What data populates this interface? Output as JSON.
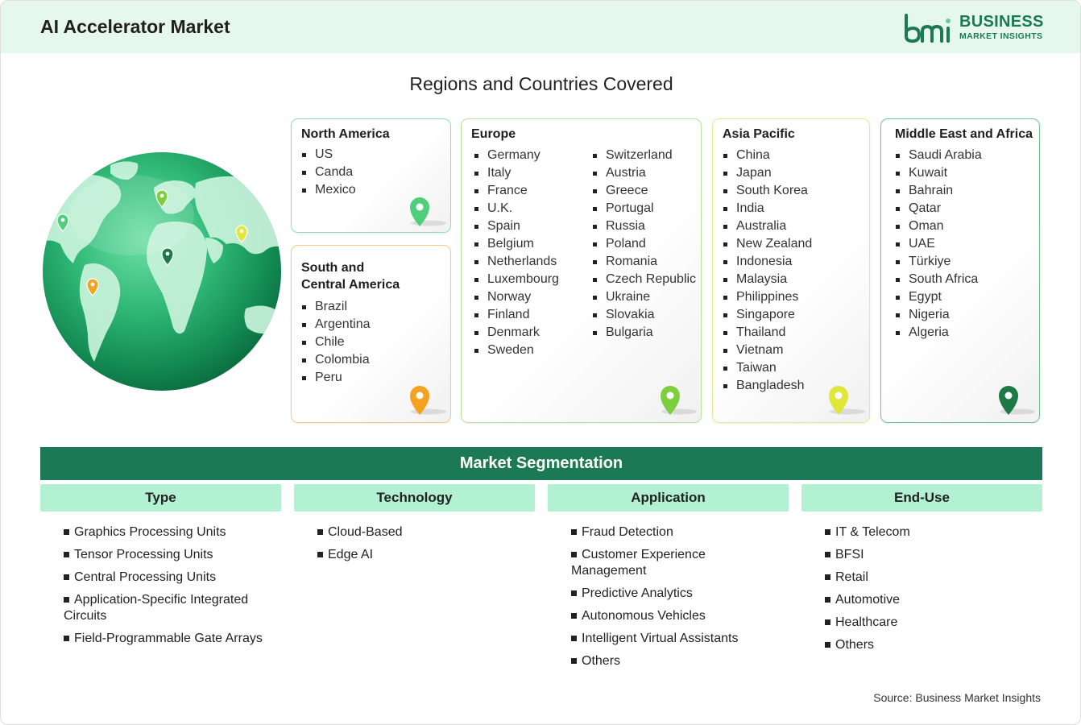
{
  "header": {
    "title": "AI Accelerator Market"
  },
  "logo": {
    "line1": "BUSINESS",
    "line2": "MARKET INSIGHTS"
  },
  "subtitle": "Regions and Countries Covered",
  "regions": {
    "north_america": {
      "title": "North America",
      "countries": [
        "US",
        "Canda",
        "Mexico"
      ],
      "pin_color": "#4fcf7b"
    },
    "south_central_america": {
      "title_line1": "South and",
      "title_line2": "Central America",
      "countries": [
        "Brazil",
        "Argentina",
        "Chile",
        "Colombia",
        "Peru"
      ],
      "pin_color": "#f5a21f"
    },
    "europe": {
      "title": "Europe",
      "col1": [
        "Germany",
        "Italy",
        "France",
        "U.K.",
        "Spain",
        "Belgium",
        "Netherlands",
        "Luxembourg",
        "Norway",
        "Finland",
        "Denmark",
        "Sweden"
      ],
      "col2": [
        "Switzerland",
        "Austria",
        "Greece",
        "Portugal",
        "Russia",
        "Poland",
        "Romania",
        "Czech Republic",
        "Ukraine",
        "Slovakia",
        "Bulgaria"
      ],
      "pin_color": "#7ccf3f"
    },
    "asia_pacific": {
      "title": "Asia Pacific",
      "countries": [
        "China",
        "Japan",
        "South Korea",
        "India",
        "Australia",
        "New Zealand",
        "Indonesia",
        "Malaysia",
        "Philippines",
        "Singapore",
        "Thailand",
        "Vietnam",
        "Taiwan",
        "Bangladesh"
      ],
      "pin_color": "#e2e63a"
    },
    "mea": {
      "title": "Middle East and Africa",
      "countries": [
        "Saudi Arabia",
        "Kuwait",
        "Bahrain",
        "Qatar",
        "Oman",
        "UAE",
        "Türkiye",
        "South Africa",
        "Egypt",
        "Nigeria",
        "Algeria"
      ],
      "pin_color": "#1b7a45"
    }
  },
  "segmentation": {
    "title": "Market Segmentation",
    "columns": [
      {
        "head": "Type",
        "items": [
          "Graphics Processing Units",
          "Tensor Processing Units",
          "Central Processing Units",
          "Application-Specific Integrated Circuits",
          "Field-Programmable Gate Arrays"
        ]
      },
      {
        "head": "Technology",
        "items": [
          "Cloud-Based",
          "Edge AI"
        ]
      },
      {
        "head": "Application",
        "items": [
          "Fraud Detection",
          "Customer Experience Management",
          "Predictive Analytics",
          "Autonomous Vehicles",
          "Intelligent Virtual Assistants",
          "Others"
        ]
      },
      {
        "head": "End-Use",
        "items": [
          "IT & Telecom",
          "BFSI",
          "Retail",
          "Automotive",
          "Healthcare",
          "Others"
        ]
      }
    ]
  },
  "source": "Source: Business Market Insights",
  "colors": {
    "brand": "#1b7a55",
    "header_bg": "#e6f8ee",
    "seg_head_bg": "#b2f2d2"
  }
}
